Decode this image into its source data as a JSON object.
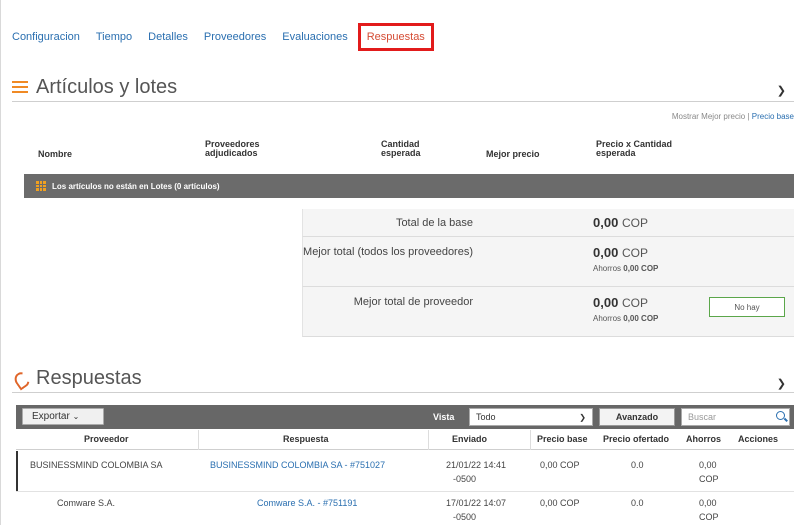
{
  "nav": {
    "tabs": [
      "Configuracion",
      "Tiempo",
      "Detalles",
      "Proveedores",
      "Evaluaciones",
      "Respuestas"
    ],
    "active_tab": "Respuestas"
  },
  "items_section": {
    "title": "Artículos y lotes",
    "show_best_price": "Mostrar Mejor precio",
    "separator": "|",
    "base_price_link": "Precio base",
    "columns": {
      "name": "Nombre",
      "awarded_suppliers": "Proveedores adjudicados",
      "expected_qty": "Cantidad esperada",
      "best_price": "Mejor precio",
      "price_x_qty": "Precio x Cantidad esperada"
    },
    "group_bar": "Los artículos no están en Lotes (0 artículos)",
    "totals": [
      {
        "label": "Total de la base",
        "value": "0,00",
        "currency": "COP",
        "savings_label": "",
        "savings_value": ""
      },
      {
        "label": "Mejor total (todos los proveedores)",
        "value": "0,00",
        "currency": "COP",
        "savings_label": "Ahorros",
        "savings_value": "0,00 COP"
      },
      {
        "label": "Mejor total de proveedor",
        "value": "0,00",
        "currency": "COP",
        "savings_label": "Ahorros",
        "savings_value": "0,00 COP",
        "button": "No hay"
      }
    ]
  },
  "responses_section": {
    "title": "Respuestas",
    "export_label": "Exportar",
    "view_label": "Vista",
    "view_value": "Todo",
    "advanced_label": "Avanzado",
    "search_placeholder": "Buscar",
    "columns": [
      "Proveedor",
      "Respuesta",
      "Enviado",
      "Precio base",
      "Precio ofertado",
      "Ahorros",
      "Acciones"
    ],
    "rows": [
      {
        "supplier": "BUSINESSMIND COLOMBIA SA",
        "response": "BUSINESSMIND COLOMBIA SA - #751027",
        "sent": "21/01/22 14:41",
        "sent_tz": "-0500",
        "base_price": "0,00 COP",
        "offered_price": "0.0",
        "savings": "0,00",
        "savings_unit": "COP"
      },
      {
        "supplier": "Comware S.A.",
        "response": "Comware S.A. - #751191",
        "sent": "17/01/22 14:07",
        "sent_tz": "-0500",
        "base_price": "0,00 COP",
        "offered_price": "0.0",
        "savings": "0,00",
        "savings_unit": "COP"
      }
    ]
  },
  "colors": {
    "link": "#2a6fb0",
    "active_tab": "#d54c34",
    "highlight_box": "#e21b1b",
    "dark_bar": "#6b6b6b",
    "accent_orange": "#f08a24",
    "no_hay_border": "#5ba64a"
  },
  "icons": {
    "items_section": "list-icon",
    "responses_section": "responses-icon",
    "group_bar": "grid-icon",
    "collapse": "chevron-down-icon",
    "search": "search-icon"
  }
}
